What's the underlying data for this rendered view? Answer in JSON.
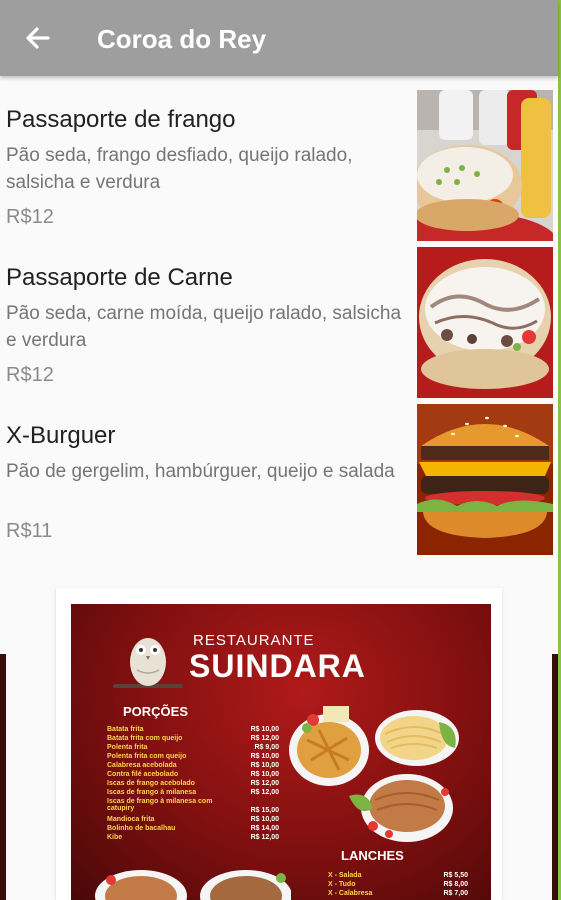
{
  "app": {
    "title": "Coroa do Rey"
  },
  "items": [
    {
      "name": "Passaporte de frango",
      "description": "Pão seda, frango desfiado, queijo ralado, salsicha e verdura",
      "price": "R$12",
      "image": "hot-dog-frango-photo"
    },
    {
      "name": "Passaporte de Carne",
      "description": "Pão seda, carne moída, queijo ralado, salsicha e verdura",
      "price": "R$12",
      "image": "hot-dog-carne-photo"
    },
    {
      "name": "X-Burguer",
      "description": "Pão de gergelim, hambúrguer, queijo e salada",
      "price": "R$11",
      "image": "burger-photo"
    }
  ],
  "menu_banner": {
    "label": "RESTAURANTE",
    "name": "SUINDARA",
    "porcoes_title": "PORÇÕES",
    "porcoes": [
      {
        "name": "Batata frita",
        "price": "R$ 10,00"
      },
      {
        "name": "Batata frita com queijo",
        "price": "R$ 12,00"
      },
      {
        "name": "Polenta frita",
        "price": "R$ 9,00"
      },
      {
        "name": "Polenta frita com queijo",
        "price": "R$ 10,00"
      },
      {
        "name": "Calabresa acebolada",
        "price": "R$ 10,00"
      },
      {
        "name": "Contra filé acebolado",
        "price": "R$ 10,00"
      },
      {
        "name": "Iscas de frango acebolado",
        "price": "R$ 12,00"
      },
      {
        "name": "Iscas de frango à milanesa",
        "price": "R$ 12,00"
      },
      {
        "name": "Iscas de frango à milanesa com catupiry",
        "price": "R$ 15,00"
      },
      {
        "name": "Mandioca frita",
        "price": "R$ 10,00"
      },
      {
        "name": "Bolinho de bacalhau",
        "price": "R$ 14,00"
      },
      {
        "name": "Kibe",
        "price": "R$ 12,00"
      }
    ],
    "lanches_title": "LANCHES",
    "lanches": [
      {
        "name": "X - Salada",
        "price": "R$ 5,50"
      },
      {
        "name": "X - Tudo",
        "price": "R$ 8,00"
      },
      {
        "name": "X - Calabresa",
        "price": "R$ 7,00"
      }
    ]
  },
  "colors": {
    "appbar": "#9e9e9e",
    "accent_edge": "#8bc34a",
    "banner_red": "#9b1515"
  }
}
